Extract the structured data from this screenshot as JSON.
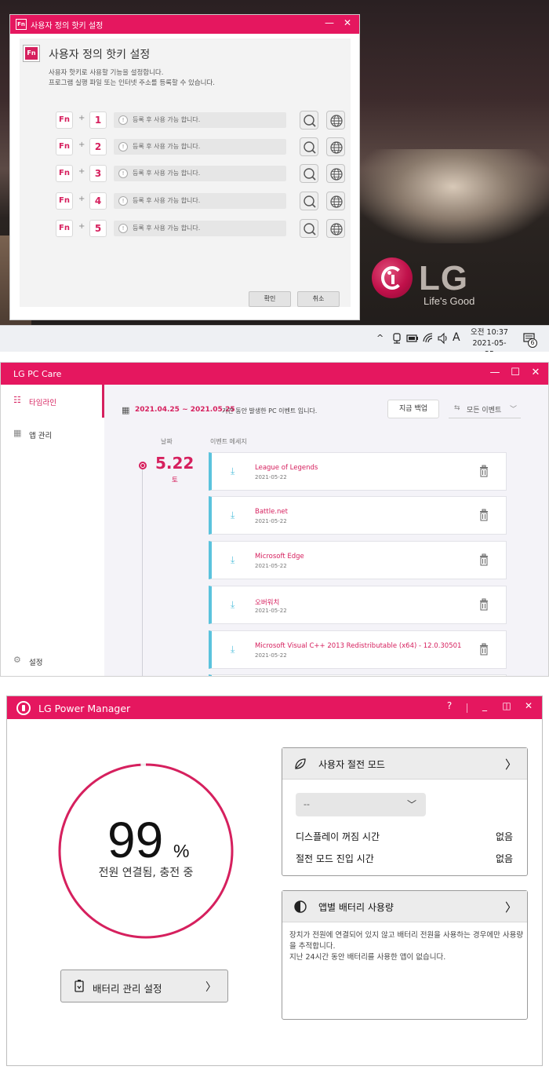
{
  "hotkey_dialog": {
    "window_title": "사용자 정의 핫키 설정",
    "icon_label": "Fn",
    "heading": "사용자 정의 핫키 설정",
    "description_line1": "사용자 핫키로 사용할 기능을 설정합니다.",
    "description_line2": "프로그램 실행 파일 또는 인터넷 주소를 등록할 수 있습니다.",
    "rows": [
      {
        "fn": "Fn",
        "plus": "+",
        "key": "1",
        "placeholder": "등록 후 사용 가능 합니다."
      },
      {
        "fn": "Fn",
        "plus": "+",
        "key": "2",
        "placeholder": "등록 후 사용 가능 합니다."
      },
      {
        "fn": "Fn",
        "plus": "+",
        "key": "3",
        "placeholder": "등록 후 사용 가능 합니다."
      },
      {
        "fn": "Fn",
        "plus": "+",
        "key": "4",
        "placeholder": "등록 후 사용 가능 합니다."
      },
      {
        "fn": "Fn",
        "plus": "+",
        "key": "5",
        "placeholder": "등록 후 사용 가능 합니다."
      }
    ],
    "ok_label": "확인",
    "cancel_label": "취소",
    "minimize_glyph": "—",
    "close_glyph": "✕",
    "accent_color": "#e5175f"
  },
  "desktop": {
    "brand": "LG",
    "slogan": "Life's Good"
  },
  "taskbar": {
    "tray_chevron": "^",
    "ime_label": "A",
    "time": "오전 10:37",
    "date": "2021-05-25",
    "notification_count": "6"
  },
  "pc_care": {
    "window_title": "LG PC Care",
    "sidebar": [
      {
        "label": "타임라인",
        "icon": "timeline-icon",
        "active": true
      },
      {
        "label": "앱 관리",
        "icon": "apps-grid-icon",
        "active": false
      }
    ],
    "settings_label": "설정",
    "date_range": "2021.04.25 ~ 2021.05.25",
    "date_range_suffix": "기간 동안 발생한 PC 이벤트 입니다.",
    "backup_button": "지금 백업",
    "filter_label": "모든 이벤트",
    "column_date": "날짜",
    "column_message": "이벤트 메세지",
    "timeline_date": "5.22",
    "timeline_day": "토",
    "events": [
      {
        "name": "League of Legends",
        "date": "2021-05-22"
      },
      {
        "name": "Battle.net",
        "date": "2021-05-22"
      },
      {
        "name": "Microsoft Edge",
        "date": "2021-05-22"
      },
      {
        "name": "오버워치",
        "date": "2021-05-22"
      },
      {
        "name": "Microsoft Visual C++ 2013 Redistributable (x64) - 12.0.30501",
        "date": "2021-05-22"
      }
    ],
    "accent_color": "#d6205e",
    "event_bar_color": "#5bc3dd"
  },
  "power_manager": {
    "window_title": "LG Power Manager",
    "help_glyph": "?",
    "battery_percent": "99",
    "percent_sign": "%",
    "battery_level": 0.99,
    "status": "전원 연결됨, 충전 중",
    "battery_settings_button": "배터리 관리 설정",
    "power_saving_panel": {
      "title": "사용자 절전 모드",
      "mode_value": "--",
      "display_off_label": "디스플레이 꺼짐 시간",
      "display_off_value": "없음",
      "sleep_label": "절전 모드 진입 시간",
      "sleep_value": "없음"
    },
    "app_battery_panel": {
      "title": "앱별 배터리 사용량",
      "description": "장치가 전원에 연결되어 있지 않고 배터리 전원을 사용하는 경우에만 사용량을 추적합니다.",
      "empty_message": "지난 24시간 동안 배터리를 사용한 앱이 없습니다."
    },
    "ring_color": "#d6205e"
  }
}
